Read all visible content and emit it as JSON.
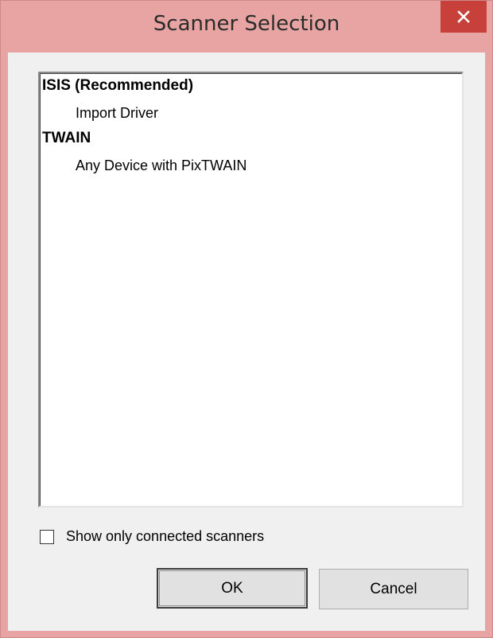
{
  "window": {
    "title": "Scanner Selection",
    "close_icon": "close-icon",
    "accent_color": "#e7a4a2",
    "close_color": "#c7403a"
  },
  "list": {
    "groups": [
      {
        "header": "ISIS (Recommended)",
        "items": [
          "Import Driver"
        ]
      },
      {
        "header": "TWAIN",
        "items": [
          "Any Device with PixTWAIN"
        ]
      }
    ]
  },
  "checkbox": {
    "label": "Show only connected scanners",
    "checked": false
  },
  "buttons": {
    "ok_label": "OK",
    "cancel_label": "Cancel"
  }
}
